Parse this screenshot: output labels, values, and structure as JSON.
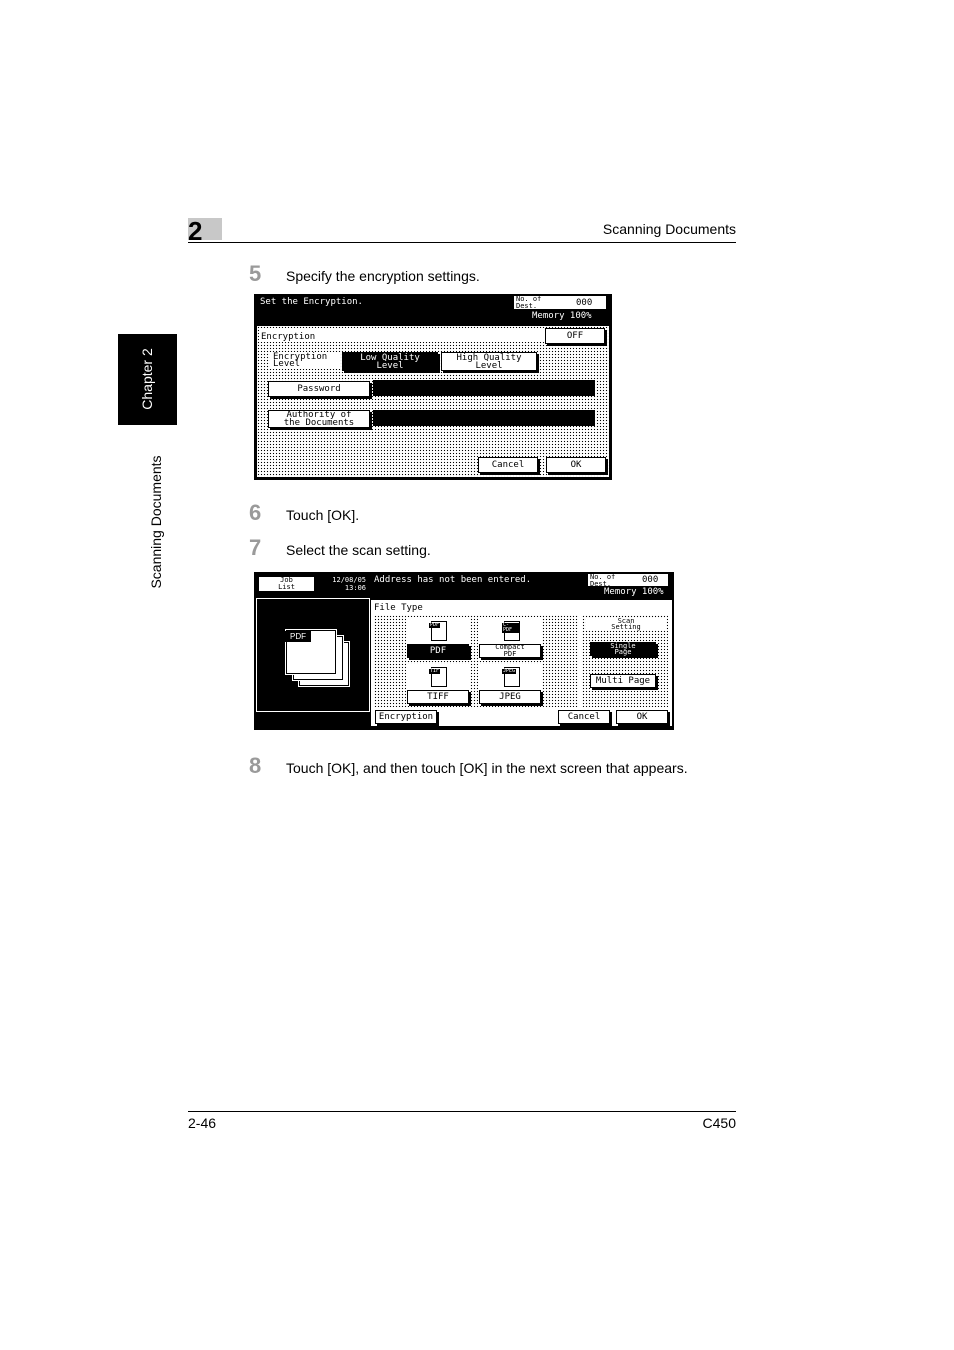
{
  "header": {
    "chapter_number": "2",
    "section_title": "Scanning Documents"
  },
  "side_tab": {
    "chapter_label": "Chapter 2",
    "section_label": "Scanning Documents"
  },
  "steps": [
    {
      "number": "5",
      "text": "Specify the encryption settings."
    },
    {
      "number": "6",
      "text": "Touch [OK]."
    },
    {
      "number": "7",
      "text": "Select the scan setting."
    },
    {
      "number": "8",
      "text": "Touch [OK], and then touch [OK] in the next screen that appears."
    }
  ],
  "screen1": {
    "title": "Set the Encryption.",
    "dest_label": "No. of\nDest.",
    "dest_value": "000",
    "memory": "Memory 100%",
    "panel_title": "Encryption",
    "off_button": "OFF",
    "level_label": "Encryption\nLevel",
    "low_quality": "Low Quality\nLevel",
    "high_quality": "High Quality\nLevel",
    "password_button": "Password",
    "authority_button": "Authority of\nthe Documents",
    "cancel_button": "Cancel",
    "ok_button": "OK"
  },
  "screen2": {
    "job_list": "Job\nList",
    "datetime": "12/08/05\n13:06",
    "preview_label": "PDF",
    "message": "Address has not been entered.",
    "dest_label": "No. of\nDest.",
    "dest_value": "000",
    "memory": "Memory 100%",
    "file_type_label": "File Type",
    "pdf_button": "PDF",
    "compact_pdf_button": "Compact\nPDF",
    "tiff_button": "TIFF",
    "jpeg_button": "JPEG",
    "icon_pdf": "PDF",
    "icon_cpdf": "C-PDF",
    "icon_tiff": "TIF",
    "icon_jpeg": "JPEG",
    "scan_setting_label": "Scan\nSetting",
    "single_page_button": "Single\nPage",
    "multi_page_button": "Multi Page",
    "encryption_button": "Encryption",
    "cancel_button": "Cancel",
    "ok_button": "OK"
  },
  "footer": {
    "page_number": "2-46",
    "model": "C450"
  }
}
